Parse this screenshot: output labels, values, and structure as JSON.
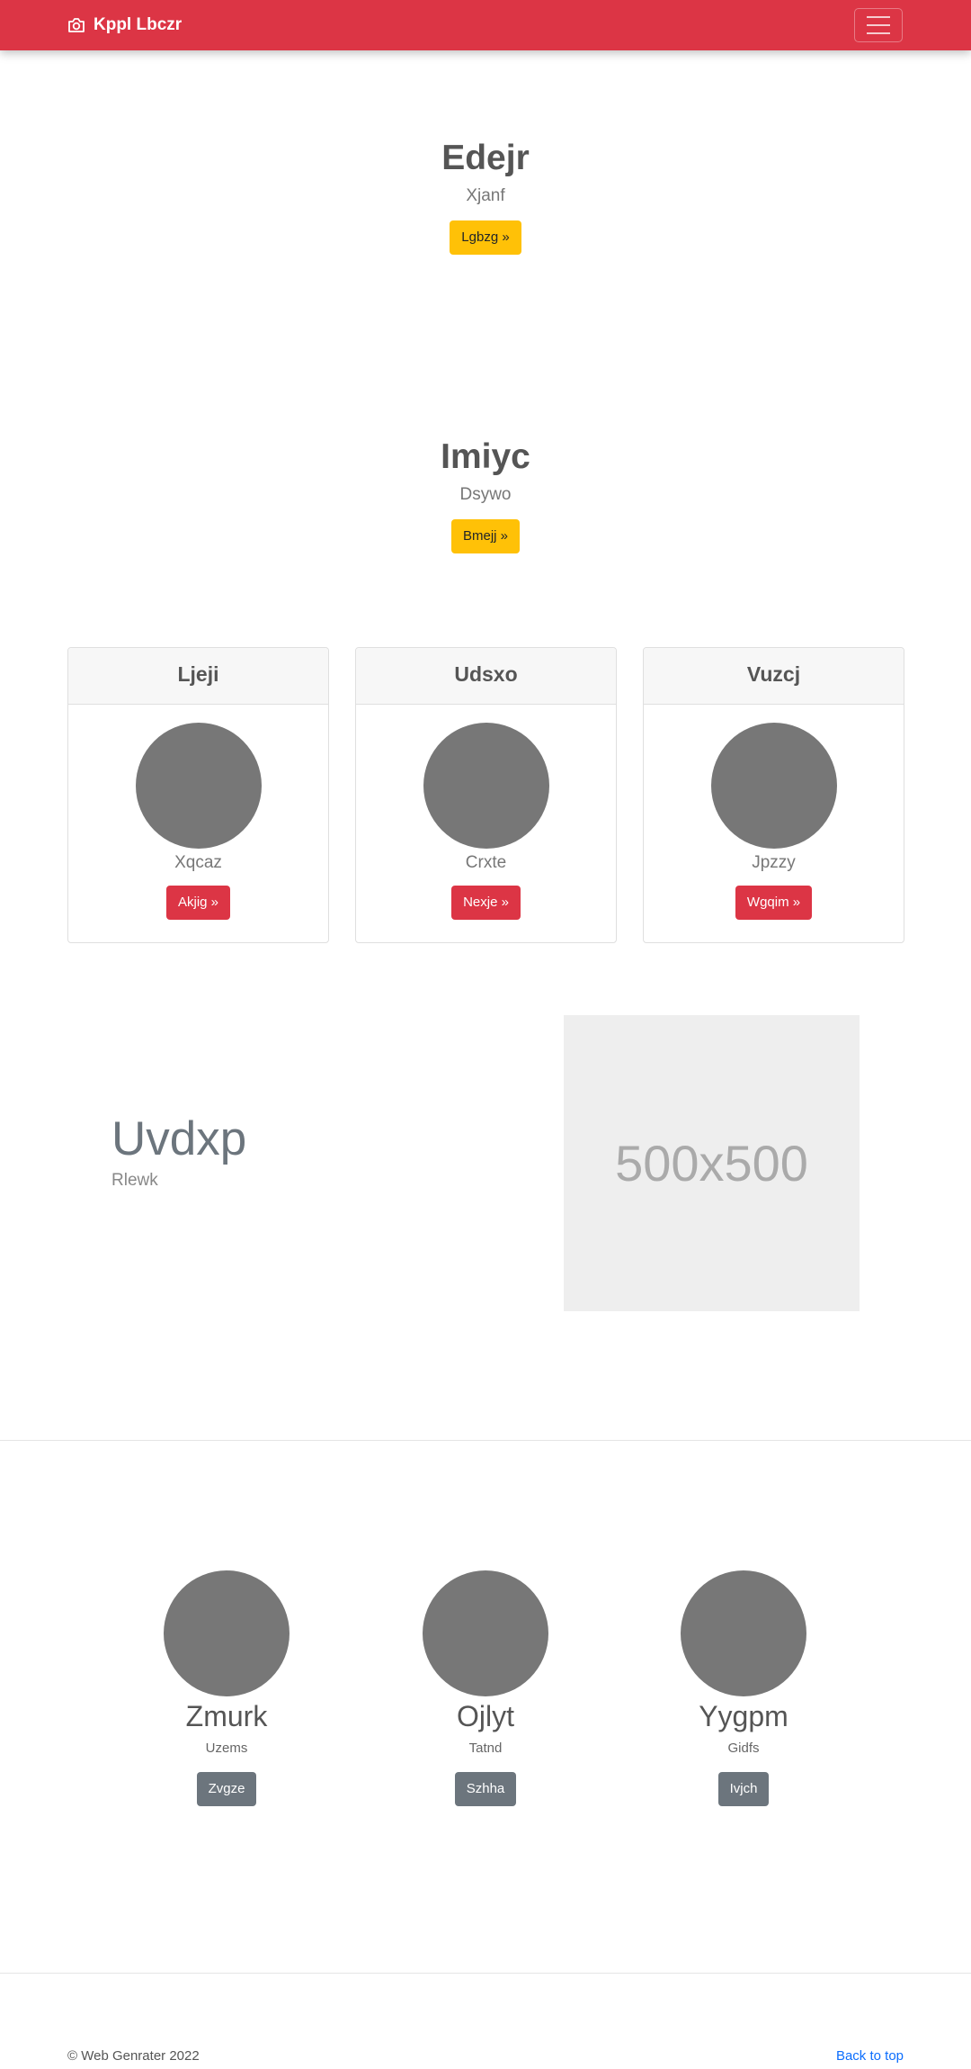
{
  "navbar": {
    "brand": "Kppl Lbczr",
    "brand_icon": "camera-icon",
    "toggler_icon": "hamburger-icon",
    "color": "#dc3545"
  },
  "heroes": [
    {
      "title": "Edejr",
      "subtitle": "Xjanf",
      "button": "Lgbzg »"
    },
    {
      "title": "Imiyc",
      "subtitle": "Dsywo",
      "button": "Bmejj »"
    }
  ],
  "cards": [
    {
      "header": "Ljeji",
      "text": "Xqcaz",
      "button": "Akjig »"
    },
    {
      "header": "Udsxo",
      "text": "Crxte",
      "button": "Nexje »"
    },
    {
      "header": "Vuzcj",
      "text": "Jpzzy",
      "button": "Wgqim »"
    }
  ],
  "feature": {
    "title": "Uvdxp",
    "subtitle": "Rlewk",
    "image_label": "500x500"
  },
  "people": [
    {
      "name": "Zmurk",
      "role": "Uzems",
      "button": "Zvgze"
    },
    {
      "name": "Ojlyt",
      "role": "Tatnd",
      "button": "Szhha"
    },
    {
      "name": "Yygpm",
      "role": "Gidfs",
      "button": "Ivjch"
    }
  ],
  "footer": {
    "copyright": "© Web Genrater 2022",
    "back_to_top": "Back to top"
  },
  "colors": {
    "primary": "#dc3545",
    "warning": "#ffc107",
    "secondary": "#6c757d",
    "link": "#0d6efd"
  }
}
